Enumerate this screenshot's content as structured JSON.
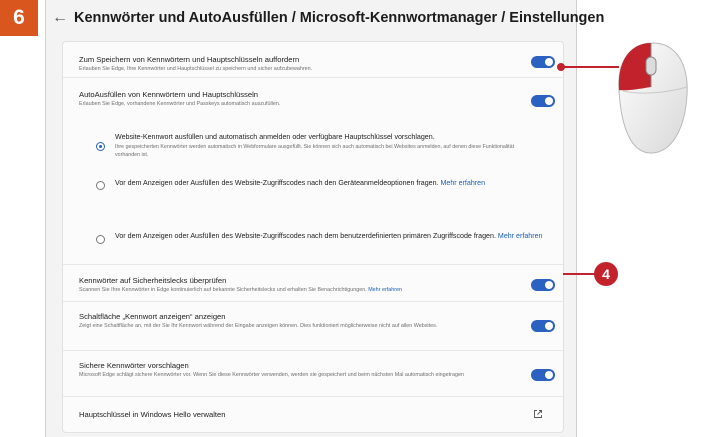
{
  "step_number": "6",
  "callout_number": "4",
  "window": {
    "title": "Kennwörter und AutoAusfüllen / Microsoft-Kennwortmanager / Einstellungen",
    "back_icon": "arrow-left-icon"
  },
  "settings": {
    "save_prompt": {
      "title": "Zum Speichern von Kennwörtern und Hauptschlüsseln auffordern",
      "desc": "Erlauben Sie Edge, Ihre Kennwörter und Hauptschlüssel zu speichern und sicher aufzubewahren.",
      "enabled": true
    },
    "autofill": {
      "title": "AutoAusfüllen von Kennwörtern und Hauptschlüsseln",
      "desc": "Erlauben Sie Edge, vorhandene Kennwörter und Passkeys automatisch auszufüllen.",
      "enabled": true
    },
    "options": [
      {
        "text": "Website-Kennwort ausfüllen und automatisch anmelden oder verfügbare Hauptschlüssel vorschlagen.",
        "desc": "Ihre gespeicherten Kennwörter werden automatisch in Webformulare ausgefüllt. Sie können sich auch automatisch bei Websites anmelden, auf denen diese Funktionalität vorhanden ist.",
        "selected": true
      },
      {
        "text": "Vor dem Anzeigen oder Ausfüllen des Website-Zugriffscodes nach den Geräteanmeldeoptionen fragen.",
        "link": "Mehr erfahren",
        "selected": false
      },
      {
        "text": "Vor dem Anzeigen oder Ausfüllen des Website-Zugriffscodes nach dem benutzerdefinierten primären Zugriffscode fragen.",
        "link": "Mehr erfahren",
        "selected": false
      }
    ],
    "leak_check": {
      "title": "Kennwörter auf Sicherheitslecks überprüfen",
      "desc": "Scannen Sie Ihre Kennwörter in Edge kontinuierlich auf bekannte Sicherheitslecks und erhalten Sie Benachrichtigungen.",
      "link": "Mehr erfahren",
      "enabled": true
    },
    "reveal_button": {
      "title": "Schaltfläche „Kennwort anzeigen“ anzeigen",
      "desc": "Zeigt eine Schaltfläche an, mit der Sie Ihr Kennwort während der Eingabe anzeigen können. Dies funktioniert möglicherweise nicht auf allen Websites.",
      "enabled": true
    },
    "suggest_strong": {
      "title": "Sichere Kennwörter vorschlagen",
      "desc": "Microsoft Edge schlägt sichere Kennwörter vor. Wenn Sie diese Kennwörter verwenden, werden sie gespeichert und beim nächsten Mal automatisch eingetragen",
      "enabled": true
    },
    "hello": {
      "title": "Hauptschlüssel in Windows Hello verwalten",
      "icon": "external-link-icon"
    }
  },
  "colors": {
    "step_badge": "#d9571f",
    "toggle_on": "#2b62c1",
    "callout": "#c2222c",
    "link": "#1a5fb4"
  }
}
